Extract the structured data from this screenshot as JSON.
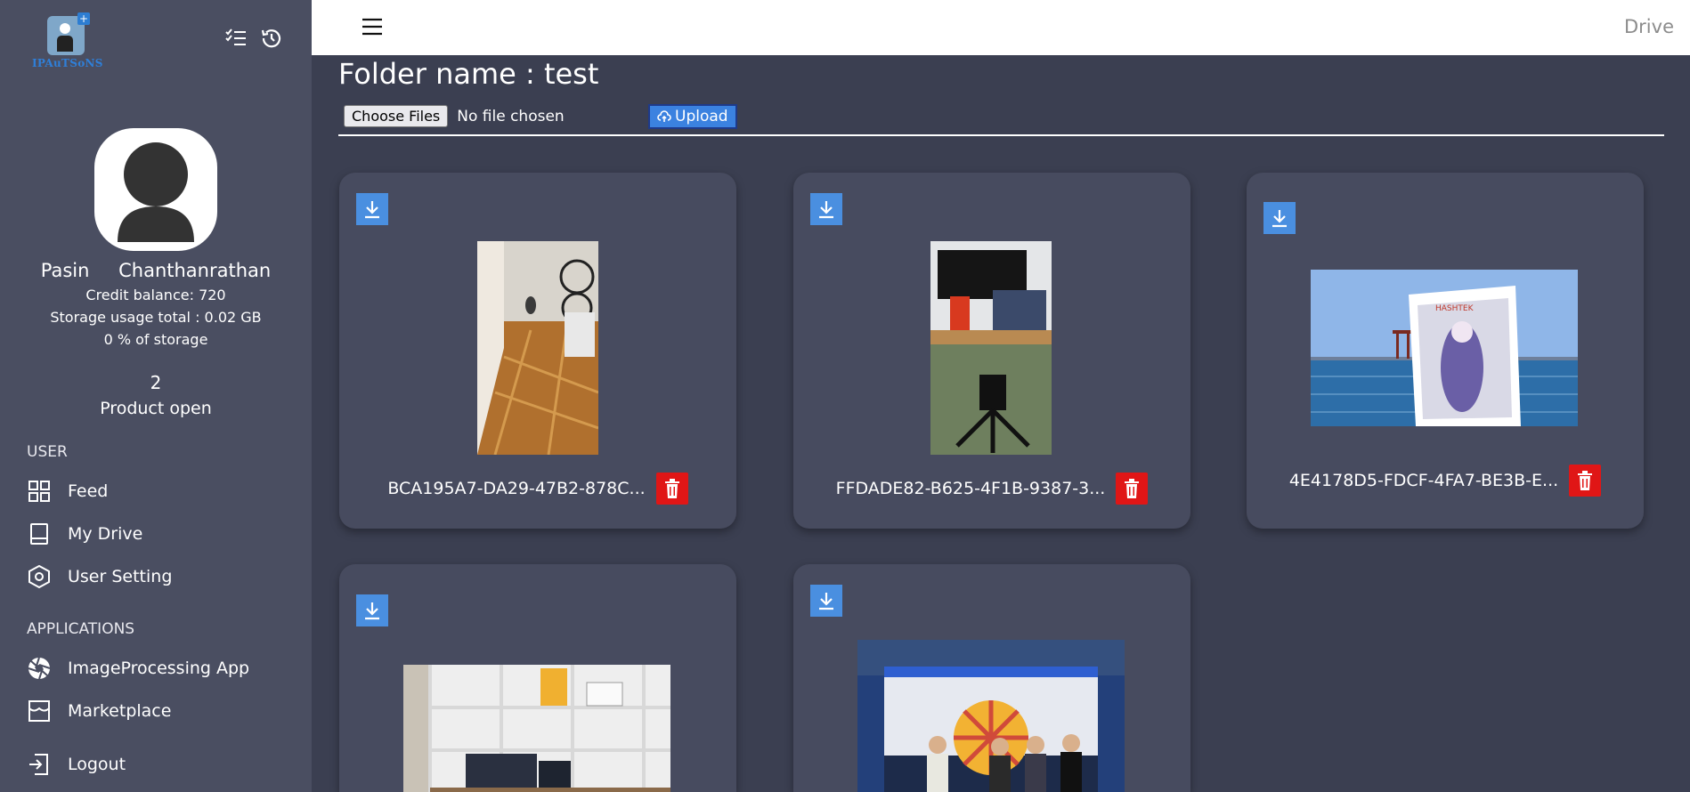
{
  "app": {
    "logo_text": "IPAuTSoNS",
    "topbar_title": "Drive"
  },
  "user": {
    "name": "Pasin Chanthanrathan",
    "credit_balance": "Credit balance: 720",
    "storage_usage": "Storage usage total : 0.02 GB",
    "storage_percent": "0 % of storage",
    "product_count": "2",
    "product_label": "Product open"
  },
  "sidebar": {
    "user_section": "USER",
    "user_items": [
      {
        "label": "Feed",
        "icon": "grid-icon"
      },
      {
        "label": "My Drive",
        "icon": "drive-icon"
      },
      {
        "label": "User Setting",
        "icon": "hexagon-settings-icon"
      }
    ],
    "apps_section": "APPLICATIONS",
    "app_items": [
      {
        "label": "ImageProcessing App",
        "icon": "aperture-icon"
      },
      {
        "label": "Marketplace",
        "icon": "store-icon"
      }
    ],
    "logout_label": "Logout"
  },
  "main": {
    "folder_title": "Folder name : test",
    "choose_files_label": "Choose Files",
    "no_file_text": "No file chosen",
    "upload_label": "Upload"
  },
  "files": [
    {
      "name": "BCA195A7-DA29-47B2-878C..."
    },
    {
      "name": "FFDADE82-B625-4F1B-9387-3..."
    },
    {
      "name": "4E4178D5-FDCF-4FA7-BE3B-E..."
    },
    {
      "name": ""
    },
    {
      "name": ""
    }
  ],
  "colors": {
    "sidebar_bg": "#4a4e61",
    "main_bg": "#3b3f51",
    "card_bg": "#474b5f",
    "download_blue": "#4a8fe0",
    "delete_red": "#e01616",
    "upload_blue": "#3b82e0"
  }
}
